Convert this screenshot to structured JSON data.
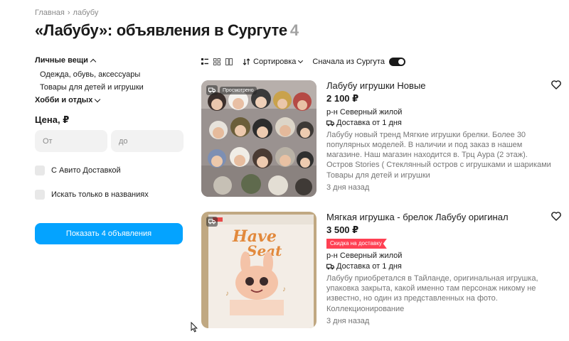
{
  "breadcrumb": {
    "home": "Главная",
    "sep": "›",
    "current": "лабубу"
  },
  "title": {
    "text": "«Лабубу»: объявления в Сургуте",
    "count": "4"
  },
  "sidebar": {
    "categories": [
      {
        "label": "Личные вещи",
        "expanded": true,
        "children": [
          "Одежда, обувь, аксессуары",
          "Товары для детей и игрушки"
        ]
      },
      {
        "label": "Хобби и отдых",
        "expanded": false,
        "children": []
      }
    ],
    "price": {
      "title": "Цена, ₽",
      "from_placeholder": "От",
      "to_placeholder": "до"
    },
    "checkboxes": [
      "С Авито Доставкой",
      "Искать только в названиях"
    ],
    "show_button": "Показать 4 объявления"
  },
  "toolbar": {
    "view_icons": [
      "list-view-icon",
      "grid-view-icon",
      "gallery-view-icon"
    ],
    "sort_label": "Сортировка",
    "toggle_label": "Сначала из Сургута",
    "toggle_on": true
  },
  "listings": [
    {
      "title": "Лабубу игрушки Новые",
      "price": "2 100 ₽",
      "image_label": "Просмотрено",
      "badge": "",
      "location": "р-н Северный жилой",
      "delivery": "Доставка от 1 дня",
      "description": "Лабубу новый тренд Мягкие игрушки брелки. Более 30 популярных моделей. В наличии и под заказ в нашем магазине. Наш магазин находится в. Трц Аура (2 этаж). Остров Stories ( Стеклянный остров с игрушками и шариками Возле Subway и…",
      "category": "Товары для детей и игрушки",
      "date": "3 дня назад"
    },
    {
      "title": "Мягкая игрушка - брелок Лабубу оригинал",
      "price": "3 500 ₽",
      "image_label": "",
      "badge": "Скидка на доставку",
      "location": "р-н Северный жилой",
      "delivery": "Доставка от 1 дня",
      "description": "Лабубу приобретался в Тайланде, оригинальная игрушка, упаковка закрыта, какой именно там персонаж никому не известно, но один из представленных на фото.",
      "category": "Коллекционирование",
      "date": "3 дня назад"
    }
  ],
  "colors": {
    "accent": "#04a3ff",
    "badge": "#ff4053",
    "muted": "#757575"
  }
}
